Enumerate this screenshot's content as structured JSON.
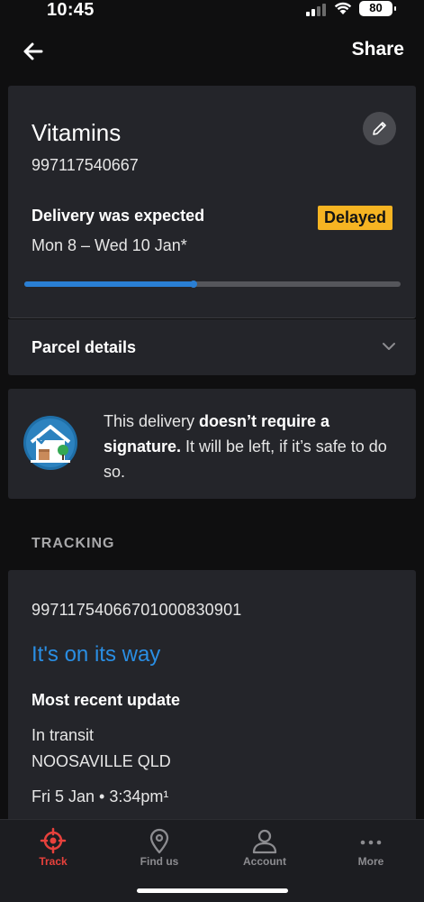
{
  "status_bar": {
    "time": "10:45",
    "battery": "80"
  },
  "nav": {
    "share_label": "Share"
  },
  "parcel": {
    "name": "Vitamins",
    "number": "997117540667",
    "delivery_label": "Delivery was expected",
    "status_badge": "Delayed",
    "delivery_window": "Mon 8 – Wed 10 Jan*",
    "progress": 0.45
  },
  "details": {
    "label": "Parcel details"
  },
  "signature": {
    "text_pre": "This delivery ",
    "text_bold": "doesn’t require a signature.",
    "text_post": " It will be left, if it’s safe to do so."
  },
  "tracking": {
    "heading": "TRACKING",
    "tracking_number": "99711754066701000830901",
    "status": "It's on its way",
    "recent_label": "Most recent update",
    "event": "In transit",
    "location": "NOOSAVILLE QLD",
    "datetime": "Fri 5 Jan • 3:34pm¹"
  },
  "tabs": [
    {
      "label": "Track",
      "icon": "target-icon",
      "active": true
    },
    {
      "label": "Find us",
      "icon": "location-pin-icon",
      "active": false
    },
    {
      "label": "Account",
      "icon": "person-icon",
      "active": false
    },
    {
      "label": "More",
      "icon": "more-dots-icon",
      "active": false
    }
  ],
  "colors": {
    "accent_blue": "#2a7fd4",
    "badge_yellow": "#f6b422",
    "active_tab_red": "#e8413c"
  }
}
